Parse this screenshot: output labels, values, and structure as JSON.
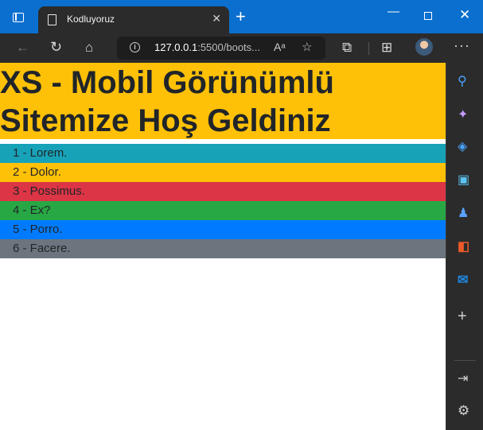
{
  "browser": {
    "tab_title": "Kodluyoruz",
    "tab_close": "✕",
    "new_tab": "+",
    "url_host": "127.0.0.1",
    "url_rest": ":5500/boots...",
    "icons": {
      "back": "arrow-left-icon",
      "reload": "reload-icon",
      "home": "home-icon",
      "info": "info-icon",
      "read_aloud": "read-aloud-icon",
      "favorites": "add-favorite-icon",
      "extensions": "puzzle-icon",
      "collections": "collections-icon",
      "more": "more-icon"
    }
  },
  "page": {
    "heading": "XS - Mobil Görünümlü Sitemize Hoş Geldiniz",
    "items": [
      {
        "label": "1 - Lorem.",
        "color": "#17a2b8"
      },
      {
        "label": "2 - Dolor.",
        "color": "#ffc107"
      },
      {
        "label": "3 - Possimus.",
        "color": "#dc3545"
      },
      {
        "label": "4 - Ex?",
        "color": "#28a745"
      },
      {
        "label": "5 - Porro.",
        "color": "#007bff"
      },
      {
        "label": "6 - Facere.",
        "color": "#6c757d"
      }
    ]
  },
  "sidebar": {
    "icons": [
      "search-icon",
      "copilot-icon",
      "shopping-tag-icon",
      "tools-icon",
      "games-icon",
      "office-icon",
      "outlook-icon",
      "add-icon",
      "panel-icon",
      "settings-icon"
    ]
  }
}
